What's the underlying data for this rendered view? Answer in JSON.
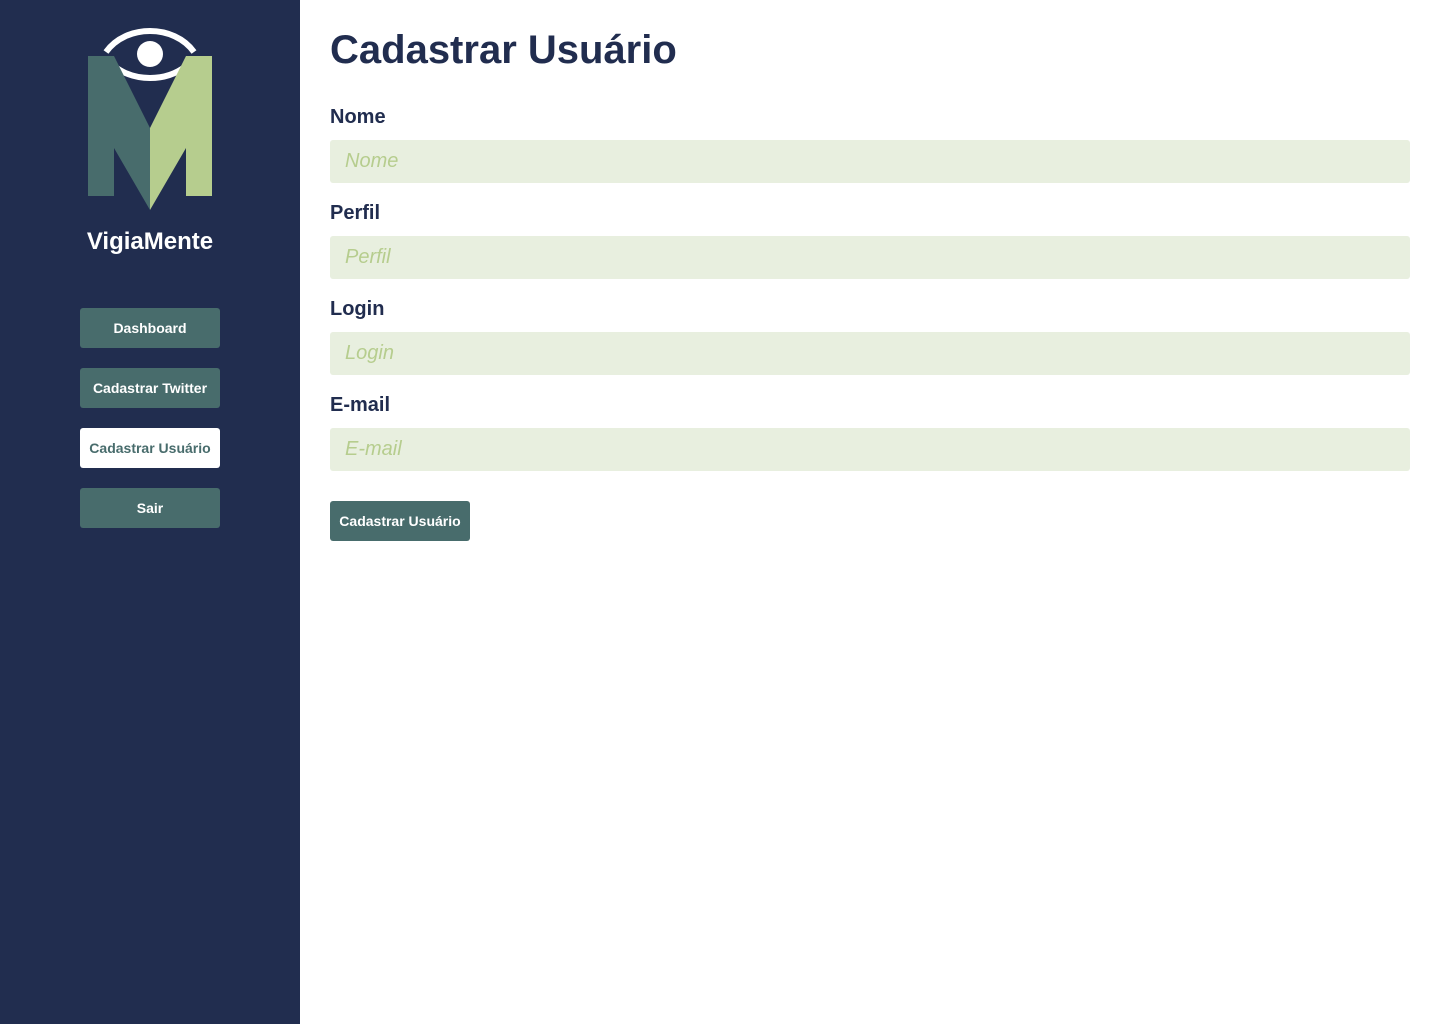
{
  "app": {
    "brand_name": "VigiaMente",
    "logo_icon": "eye-m-logo-icon"
  },
  "colors": {
    "sidebar_bg": "#212d4f",
    "button_bg": "#486c6c",
    "input_bg": "#e8efdf",
    "placeholder": "#b6cd8e",
    "title": "#212d4f"
  },
  "sidebar": {
    "items": [
      {
        "label": "Dashboard",
        "active": false
      },
      {
        "label": "Cadastrar Twitter",
        "active": false
      },
      {
        "label": "Cadastrar Usuário",
        "active": true
      },
      {
        "label": "Sair",
        "active": false
      }
    ]
  },
  "main": {
    "title": "Cadastrar Usuário",
    "fields": [
      {
        "label": "Nome",
        "placeholder": "Nome",
        "value": ""
      },
      {
        "label": "Perfil",
        "placeholder": "Perfil",
        "value": ""
      },
      {
        "label": "Login",
        "placeholder": "Login",
        "value": ""
      },
      {
        "label": "E-mail",
        "placeholder": "E-mail",
        "value": ""
      }
    ],
    "submit_label": "Cadastrar Usuário"
  }
}
